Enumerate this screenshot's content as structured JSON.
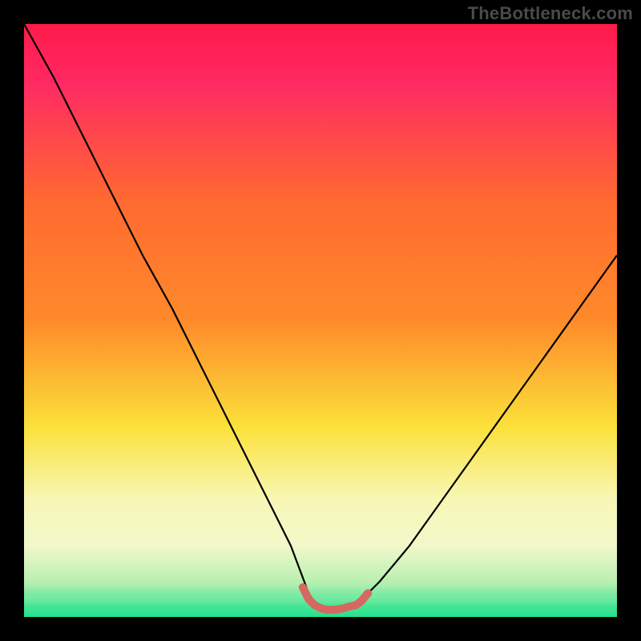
{
  "watermark": "TheBottleneck.com",
  "colors": {
    "black": "#000000",
    "curve": "#000000",
    "highlight": "#d6695f",
    "green_base": "#15e08a",
    "yellow_pale": "#f8f7b4",
    "yellow": "#fbe13a",
    "orange": "#ff8a2a",
    "red_top": "#ff1a4a",
    "red_pink": "#ff2a63"
  },
  "chart_data": {
    "type": "line",
    "title": "",
    "xlabel": "",
    "ylabel": "",
    "xlim": [
      0,
      100
    ],
    "ylim": [
      0,
      100
    ],
    "series": [
      {
        "name": "bottleneck-curve",
        "x": [
          0,
          5,
          10,
          15,
          20,
          25,
          30,
          35,
          40,
          45,
          48,
          50,
          53,
          56,
          60,
          65,
          70,
          75,
          80,
          85,
          90,
          95,
          100
        ],
        "y": [
          100,
          91,
          81,
          71,
          61,
          52,
          42,
          32,
          22,
          12,
          4,
          1,
          1,
          2,
          6,
          12,
          19,
          26,
          33,
          40,
          47,
          54,
          61
        ]
      },
      {
        "name": "optimal-range-highlight",
        "x": [
          47,
          48,
          49,
          50,
          51,
          52,
          53,
          54,
          55,
          56,
          57,
          58
        ],
        "y": [
          5,
          3,
          2,
          1.5,
          1.2,
          1.2,
          1.3,
          1.5,
          1.8,
          2,
          2.8,
          4
        ]
      }
    ],
    "annotations": [],
    "background": "vertical-gradient red→orange→yellow→pale-yellow→green with black frame"
  },
  "geometry": {
    "inner_left": 30,
    "inner_top": 30,
    "inner_width": 740,
    "inner_height": 740
  }
}
